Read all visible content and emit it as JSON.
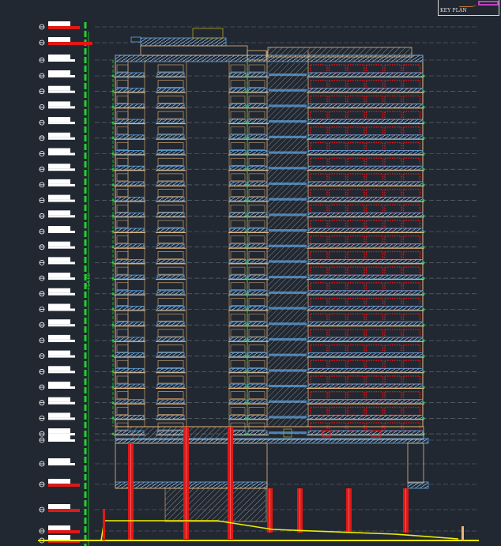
{
  "drawing": {
    "type": "building-elevation",
    "key_plan_label": "KEY PLAN",
    "total_height_label": "+54.00",
    "floors_typical": 24,
    "colors": {
      "background": "#222831",
      "frame": "#e8b77a",
      "balcony": "#5fa8e8",
      "column": "#e01818",
      "ground": "#f0f000",
      "dimension": "#22d030",
      "level_tag": "#ffffff",
      "key_plan_mark": "#c040c0"
    }
  }
}
